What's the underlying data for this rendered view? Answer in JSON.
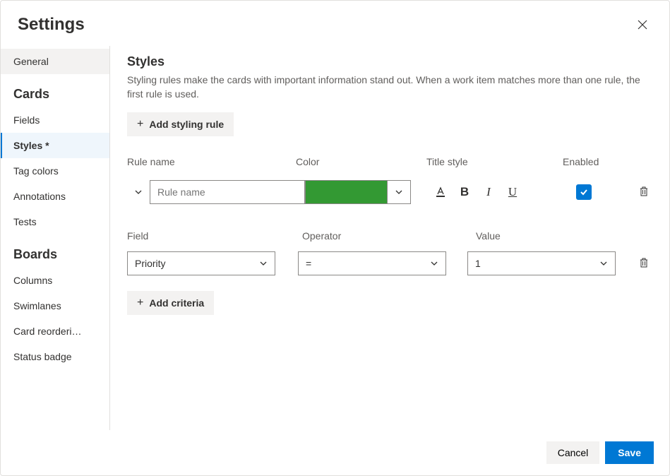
{
  "header": {
    "title": "Settings"
  },
  "sidebar": {
    "general": "General",
    "groups": [
      {
        "label": "Cards",
        "items": [
          "Fields",
          "Styles *",
          "Tag colors",
          "Annotations",
          "Tests"
        ]
      },
      {
        "label": "Boards",
        "items": [
          "Columns",
          "Swimlanes",
          "Card reorderi…",
          "Status badge"
        ]
      }
    ]
  },
  "main": {
    "heading": "Styles",
    "description": "Styling rules make the cards with important information stand out. When a work item matches more than one rule, the first rule is used.",
    "add_rule_label": "Add styling rule",
    "columns": {
      "name": "Rule name",
      "color": "Color",
      "title_style": "Title style",
      "enabled": "Enabled"
    },
    "rule": {
      "name_placeholder": "Rule name",
      "name_value": "",
      "color": "#339933",
      "enabled": true
    },
    "criteria_columns": {
      "field": "Field",
      "operator": "Operator",
      "value": "Value"
    },
    "criteria": {
      "field": "Priority",
      "operator": "=",
      "value": "1"
    },
    "add_criteria_label": "Add criteria"
  },
  "footer": {
    "cancel": "Cancel",
    "save": "Save"
  }
}
